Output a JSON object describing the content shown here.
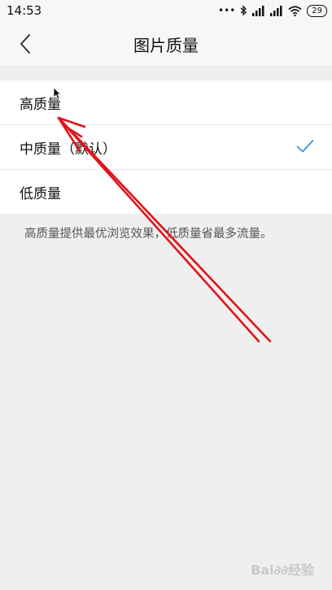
{
  "status_bar": {
    "time": "14:53",
    "signal_dots": "•••",
    "battery": "29"
  },
  "nav": {
    "title": "图片质量",
    "back_icon": "chevron-left-icon"
  },
  "options": [
    {
      "label": "高质量",
      "selected": false
    },
    {
      "label": "中质量（默认）",
      "selected": true
    },
    {
      "label": "低质量",
      "selected": false
    }
  ],
  "description": "高质量提供最优浏览效果，低质量省最多流量。",
  "colors": {
    "accent": "#3a8ee6",
    "annotation": "#e0141a",
    "background": "#efefef"
  },
  "watermark": {
    "text": "Bai∂∂经验"
  }
}
